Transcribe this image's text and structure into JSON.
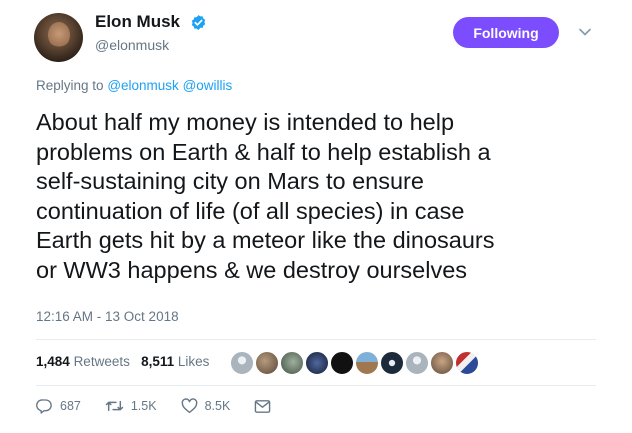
{
  "user": {
    "name": "Elon Musk",
    "handle": "@elonmusk",
    "verified": true,
    "follow_label": "Following",
    "follow_color": "#7b4dff"
  },
  "reply": {
    "prefix": "Replying to",
    "mentions": [
      "@elonmusk",
      "@owillis"
    ]
  },
  "tweet": {
    "text": "About half my money is intended to help\nproblems on Earth & half to help establish a\nself-sustaining city on Mars to ensure\ncontinuation of life (of all species) in case\nEarth gets hit by a meteor like the dinosaurs\nor WW3 happens & we destroy ourselves",
    "timestamp": "12:16 AM - 13 Oct 2018"
  },
  "stats": {
    "retweets_count": "1,484",
    "retweets_label": "Retweets",
    "likes_count": "8,511",
    "likes_label": "Likes"
  },
  "likers": [
    {
      "icon": "default-avatar",
      "color": "#a9b4bd"
    },
    {
      "icon": "dog-avatar",
      "color": "#6b5a49"
    },
    {
      "icon": "mixed-avatar",
      "color": "#5b6b5a"
    },
    {
      "icon": "space-avatar",
      "color": "#2a3550"
    },
    {
      "icon": "black-avatar",
      "color": "#111111"
    },
    {
      "icon": "landscape-avatar",
      "color": "#8a6a4a"
    },
    {
      "icon": "planet-avatar",
      "color": "#1c2a3c"
    },
    {
      "icon": "default-avatar",
      "color": "#a9b4bd"
    },
    {
      "icon": "person-avatar",
      "color": "#7a6a5a"
    },
    {
      "icon": "flag-avatar",
      "color": "#b03030"
    }
  ],
  "actions": {
    "replies": "687",
    "retweets": "1.5K",
    "likes": "8.5K"
  },
  "icons": {
    "verified": "verified-badge-icon",
    "chevron": "chevron-down-icon",
    "reply": "reply-icon",
    "retweet": "retweet-icon",
    "like": "heart-icon",
    "dm": "envelope-icon"
  },
  "colors": {
    "link": "#1da1f2",
    "secondary_text": "#657786",
    "primary_text": "#14171a"
  }
}
